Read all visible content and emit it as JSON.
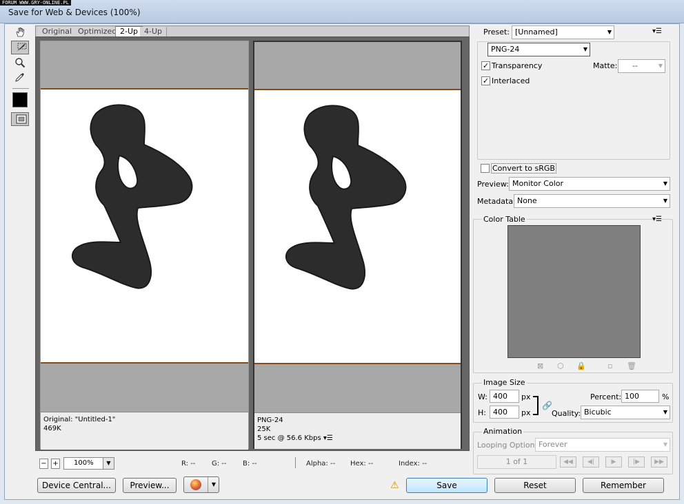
{
  "watermark": "FORUM WWW.GRY-ONLINE.PL",
  "window": {
    "title": "Save for Web & Devices (100%)"
  },
  "tools": [
    "hand-icon",
    "slice-select-icon",
    "zoom-icon",
    "eyedropper-icon",
    "color-swatch-icon",
    "toggle-slices-icon"
  ],
  "tabs": [
    "Original",
    "Optimized",
    "2-Up",
    "4-Up"
  ],
  "left_pane": {
    "line1": "Original: \"Untitled-1\"",
    "line2": "469K"
  },
  "right_pane": {
    "line1": "PNG-24",
    "line2": "25K",
    "line3": "5 sec @ 56.6 Kbps"
  },
  "status": {
    "zoom": "100%",
    "r": "R: --",
    "g": "G: --",
    "b": "B: --",
    "alpha": "Alpha: --",
    "hex": "Hex: --",
    "index": "Index: --"
  },
  "buttons": {
    "device_central": "Device Central...",
    "preview": "Preview...",
    "save": "Save",
    "reset": "Reset",
    "remember": "Remember"
  },
  "settings": {
    "preset_label": "Preset:",
    "preset_value": "[Unnamed]",
    "format": "PNG-24",
    "transparency": "Transparency",
    "transparency_checked": true,
    "matte_label": "Matte:",
    "matte_value": "--",
    "interlaced": "Interlaced",
    "interlaced_checked": true,
    "convert_srgb": "Convert to sRGB",
    "convert_srgb_checked": false,
    "preview_label": "Preview:",
    "preview_value": "Monitor Color",
    "metadata_label": "Metadata:",
    "metadata_value": "None"
  },
  "color_table": {
    "title": "Color Table"
  },
  "image_size": {
    "title": "Image Size",
    "w_label": "W:",
    "w": "400",
    "w_unit": "px",
    "h_label": "H:",
    "h": "400",
    "h_unit": "px",
    "percent_label": "Percent:",
    "percent": "100",
    "percent_unit": "%",
    "quality_label": "Quality:",
    "quality": "Bicubic"
  },
  "animation": {
    "title": "Animation",
    "looping_label": "Looping Options:",
    "looping_value": "Forever",
    "frame": "1 of 1"
  },
  "colors": {
    "accent": "#3c7fb1",
    "border": "#8a4a14"
  }
}
